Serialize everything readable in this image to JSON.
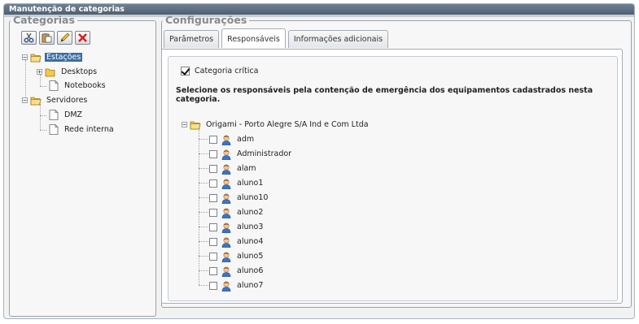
{
  "window": {
    "title": "Manutenção de categorias"
  },
  "categories": {
    "legend": "Categorias",
    "toolbar": [
      {
        "icon": "scissors-icon",
        "tooltip": ""
      },
      {
        "icon": "paste-icon",
        "tooltip": ""
      },
      {
        "icon": "pencil-icon",
        "tooltip": ""
      },
      {
        "icon": "delete-icon",
        "tooltip": ""
      }
    ],
    "tree": {
      "root1": {
        "label": "Estações",
        "selected": true
      },
      "desktops": {
        "label": "Desktops"
      },
      "notebooks": {
        "label": "Notebooks"
      },
      "root2": {
        "label": "Servidores"
      },
      "dmz": {
        "label": "DMZ"
      },
      "rede": {
        "label": "Rede interna"
      }
    }
  },
  "config": {
    "legend": "Configurações",
    "tabs": [
      "Parâmetros",
      "Responsáveis",
      "Informações adicionais"
    ],
    "active_tab": "Responsáveis",
    "critical": {
      "label": "Categoria crítica",
      "checked": true
    },
    "instruction": "Selecione os responsáveis pela contenção de emergência dos equipamentos cadastrados nesta categoria.",
    "org": {
      "label": "Origami - Porto Alegre S/A Ind e Com Ltda"
    },
    "users": [
      "adm",
      "Administrador",
      "alam",
      "aluno1",
      "aluno10",
      "aluno2",
      "aluno3",
      "aluno4",
      "aluno5",
      "aluno6",
      "aluno7"
    ]
  },
  "colors": {
    "title_bar": "#55677a",
    "selection": "#3b6ea5",
    "folder": "#f3c94a",
    "delete": "#d42020"
  }
}
